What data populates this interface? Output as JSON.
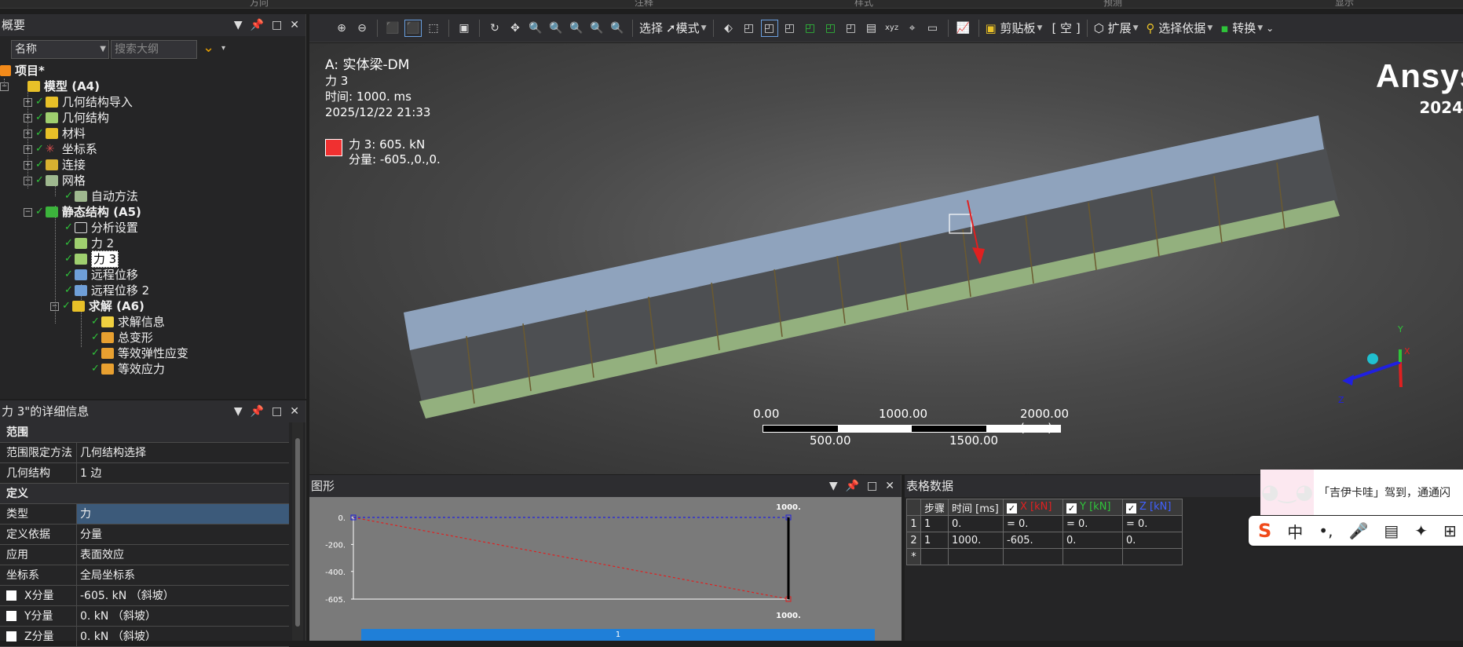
{
  "ribbon": {
    "labels": [
      "方向",
      "注释",
      "样式",
      "预测",
      "显示"
    ]
  },
  "outline": {
    "header": "概要",
    "filter_field": "名称",
    "search_placeholder": "搜索大纲",
    "items": [
      {
        "label": "项目*"
      },
      {
        "label": "模型 (A4)"
      },
      {
        "label": "几何结构导入"
      },
      {
        "label": "几何结构"
      },
      {
        "label": "材料"
      },
      {
        "label": "坐标系"
      },
      {
        "label": "连接"
      },
      {
        "label": "网格"
      },
      {
        "label": "自动方法"
      },
      {
        "label": "静态结构 (A5)"
      },
      {
        "label": "分析设置"
      },
      {
        "label": "力 2"
      },
      {
        "label": "力 3"
      },
      {
        "label": "远程位移"
      },
      {
        "label": "远程位移 2"
      },
      {
        "label": "求解 (A6)"
      },
      {
        "label": "求解信息"
      },
      {
        "label": "总变形"
      },
      {
        "label": "等效弹性应变"
      },
      {
        "label": "等效应力"
      }
    ]
  },
  "details": {
    "header": "力 3\"的详细信息",
    "rows": [
      {
        "section": "范围"
      },
      {
        "k": "范围限定方法",
        "v": "几何结构选择"
      },
      {
        "k": "几何结构",
        "v": "1 边"
      },
      {
        "section": "定义"
      },
      {
        "k": "类型",
        "v": "力"
      },
      {
        "k": "定义依据",
        "v": "分量"
      },
      {
        "k": "应用",
        "v": "表面效应"
      },
      {
        "k": "坐标系",
        "v": "全局坐标系"
      },
      {
        "k": "X分量",
        "v": "-605. kN （斜坡）"
      },
      {
        "k": "Y分量",
        "v": "0. kN （斜坡）"
      },
      {
        "k": "Z分量",
        "v": "0. kN （斜坡）"
      }
    ]
  },
  "toolbar": {
    "select": "选择",
    "mode": "模式",
    "clipboard": "剪贴板",
    "empty": "[ 空 ]",
    "extend": "扩展",
    "select_by": "选择依据",
    "convert": "转换"
  },
  "viewport": {
    "system": "A:",
    "model": "实体梁-DM",
    "load_name": "力 3",
    "time": "时间: 1000. ms",
    "date": "2025/12/22 21:33",
    "legend_line1": "力 3: 605. kN",
    "legend_line2": "分量: -605.,0.,0.",
    "brand": "Ansys",
    "brand_year": "2024",
    "axis_x": "X",
    "axis_y": "Y",
    "axis_z": "Z",
    "scale_top": [
      "0.00",
      "1000.00",
      "2000.00 (mm)"
    ],
    "scale_bottom": [
      "500.00",
      "1500.00"
    ]
  },
  "graph": {
    "header": "图形",
    "chart_data": {
      "type": "line",
      "x": [
        0,
        1000
      ],
      "series": [
        {
          "values": [
            0,
            -605
          ],
          "color": "#e02020"
        },
        {
          "values": [
            0,
            0
          ],
          "color": "#2020e0"
        }
      ],
      "ytick_labels": [
        "0.",
        "-200.",
        "-400.",
        "-605."
      ],
      "x_end_top": "1000.",
      "x_end_bottom": "1000.",
      "ylim": [
        -605,
        0
      ],
      "step_bar_label": "1"
    }
  },
  "table": {
    "header": "表格数据",
    "columns": [
      "步骤",
      "时间 [ms]",
      "X [kN]",
      "Y [kN]",
      "Z [kN]"
    ],
    "rows": [
      {
        "idx": "1",
        "cells": [
          "1",
          "0.",
          "= 0.",
          "= 0.",
          "= 0."
        ]
      },
      {
        "idx": "2",
        "cells": [
          "1",
          "1000.",
          "-605.",
          "0.",
          "0."
        ]
      },
      {
        "idx": "*",
        "cells": [
          "",
          "",
          "",
          "",
          ""
        ]
      }
    ]
  },
  "ime": {
    "bubble_text": "「吉伊卡哇」驾到，通通闪",
    "zh": "中"
  },
  "colors": {
    "beam_top": "#8fa3bd",
    "beam_side": "#4d4f52",
    "beam_bottom": "#93b07e",
    "load": "#e02020",
    "accent_blue": "#1f7fd8"
  }
}
